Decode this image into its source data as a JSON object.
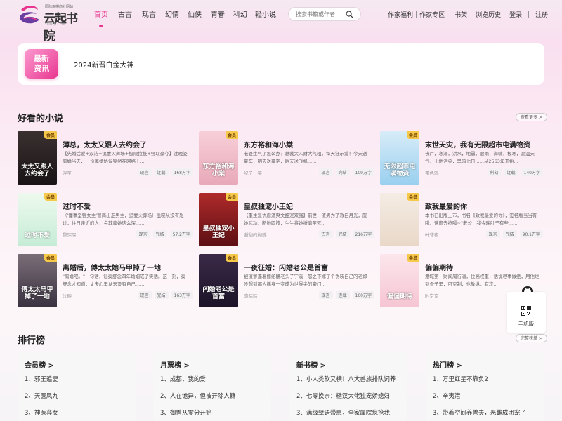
{
  "header": {
    "brand": "云起书院",
    "tagline": "国际象棋商业网站",
    "domain": "YUNQI.COM",
    "nav": [
      "首页",
      "古言",
      "现言",
      "幻情",
      "仙侠",
      "青春",
      "科幻",
      "轻小说"
    ],
    "active_nav": 0,
    "search_placeholder": "搜索书籍或作者",
    "links": {
      "author_welfare": "作家福利",
      "author_zone": "作家专区",
      "bookshelf": "书架",
      "history": "浏览历史",
      "login": "登录",
      "register": "注册"
    }
  },
  "news": {
    "badge": "最新资讯",
    "text": "2024新晋白金大神"
  },
  "recommend": {
    "title": "好看的小说",
    "more": "查看更多 >",
    "books": [
      {
        "title": "薄总，太太又跟人去约会了",
        "desc": "【先婚后爱+双洁+追妻火葬场+极限拉扯+强取豪夺】沈晚姿离婚当天，一份离婚协议突然在网络上...",
        "author": "浮笙",
        "tags": [
          "现言",
          "连载",
          "168万字"
        ],
        "cover_text": "太太又跟人去约会了",
        "vip": "会员",
        "cover_colors": [
          "#3a3030",
          "#1a1416"
        ]
      },
      {
        "title": "东方裕和海小棠",
        "desc": "老婆生气了怎么办？总裁大人财大气粗，每天狂示爱！今天送豪车，明天送豪宅，后天送飞机......",
        "author": "纪子一笑",
        "tags": [
          "现言",
          "完结",
          "109万字"
        ],
        "cover_text": "东方裕和海小棠",
        "vip": "会员",
        "cover_colors": [
          "#f7cfd8",
          "#e8a9b9"
        ]
      },
      {
        "title": "末世天灾，我有无限超市屯满物资",
        "desc": "丧尸，寒潮，洪水，地震，酸雨，海啸，极寒，高温天气，土地污染，黑暗七日......从2563年开始...",
        "author": "茶色鸦",
        "tags": [
          "科幻",
          "连载",
          "140万字"
        ],
        "cover_text": "无限超市屯满物资",
        "vip": "会员",
        "cover_colors": [
          "#d7ecf8",
          "#9ad0ef"
        ]
      },
      {
        "title": "过时不爱",
        "desc": "（'懂事坚强女主'智商出走男主，追妻火葬场）孟晓从没有想过，往日亲近的人，会欺骗她这么深......",
        "author": "黎深深",
        "tags": [
          "现言",
          "完结",
          "57.2万字"
        ],
        "cover_text": "过时不爱",
        "vip": "会员",
        "cover_colors": [
          "#eef9ee",
          "#c5ecd6"
        ]
      },
      {
        "title": "皇叔独宠小王妃",
        "desc": "【重生复仇虐渣爽文甜宠双强】前世，渣男为了救白月光，废她武功，断她四肢，生生将她折磨至死...",
        "author": "断翅的蝴蝶",
        "tags": [
          "古言",
          "完结",
          "216万字"
        ],
        "cover_text": "皇叔独宠小王妃",
        "vip": "会员",
        "cover_colors": [
          "#b02a2a",
          "#5c0f14"
        ]
      },
      {
        "title": "致我最爱的你",
        "desc": "本书已出版上市，书名《致我最爱的你》，签名版当当有哦，速度去抢嗝~\"老公，我今晚肚子有些......",
        "author": "叶非夜",
        "tags": [
          "现言",
          "完结",
          "90.1万字"
        ],
        "cover_text": "",
        "vip": "会员",
        "cover_colors": [
          "#f4ece4",
          "#e9d8c8"
        ]
      },
      {
        "title": "离婚后，傅太太她马甲掉了一地",
        "desc": "\"离婚吧。\"一句话，让秦舒念四年婚姻成了笑话。这一刻，秦舒念才知道，丈夫心里从来没有自己......",
        "author": "沈映",
        "tags": [
          "现言",
          "完结",
          "163万字"
        ],
        "cover_text": "傅太太马甲掉了一地",
        "vip": "会员",
        "cover_colors": [
          "#7a6e78",
          "#3a3240"
        ]
      },
      {
        "title": "一夜征婚：闪婚老公是首富",
        "desc": "被渣爹逼着嫁给糟老头子宁溪一怒之下嫁了个伪装自己的老却没想到那人摇身一变成为世界尖的豪门...",
        "author": "肉粽粽",
        "tags": [
          "现言",
          "连载",
          "160万字"
        ],
        "cover_text": "闪婚老公是首富",
        "vip": "会员",
        "cover_colors": [
          "#3a2a48",
          "#1c1428"
        ]
      },
      {
        "title": "偏偏期待",
        "desc": "港城第一财阀周行洲，位高权重，话说尽事做绝，用他烂到骨子里，可克制，也放纵。有次...",
        "author": "时京京",
        "tags": [
          "现言"
        ],
        "cover_text": "偏偏期待",
        "vip": "会员",
        "cover_colors": [
          "#fce6ec",
          "#f6c5d2"
        ]
      }
    ]
  },
  "ranking": {
    "title": "排行榜",
    "more": "完整榜单 >",
    "lists": [
      {
        "title": "会员榜 >",
        "items": [
          "1、邪王追妻",
          "2、天医凤九",
          "3、神医弃女"
        ]
      },
      {
        "title": "月票榜 >",
        "items": [
          "1、成都，我的爱",
          "2、人在诡异，但被开除人籍",
          "3、御兽从零分开始"
        ]
      },
      {
        "title": "新书榜 >",
        "items": [
          "1、小人类软又横！八大兽族排队饲养",
          "2、七零换亲：糙汉大佬独宠娇媳妇",
          "3、满级孽语带崽，全家属院疯抢我"
        ]
      },
      {
        "title": "热门榜 >",
        "items": [
          "1、万里红星不靠负2",
          "2、辛夷港",
          "3、带着空间养兽夫，恶雌成团宠了"
        ]
      }
    ]
  },
  "side": {
    "mobile_label": "手机版"
  },
  "colors": {
    "accent": "#e8368f",
    "vip": "#f7c94b"
  }
}
